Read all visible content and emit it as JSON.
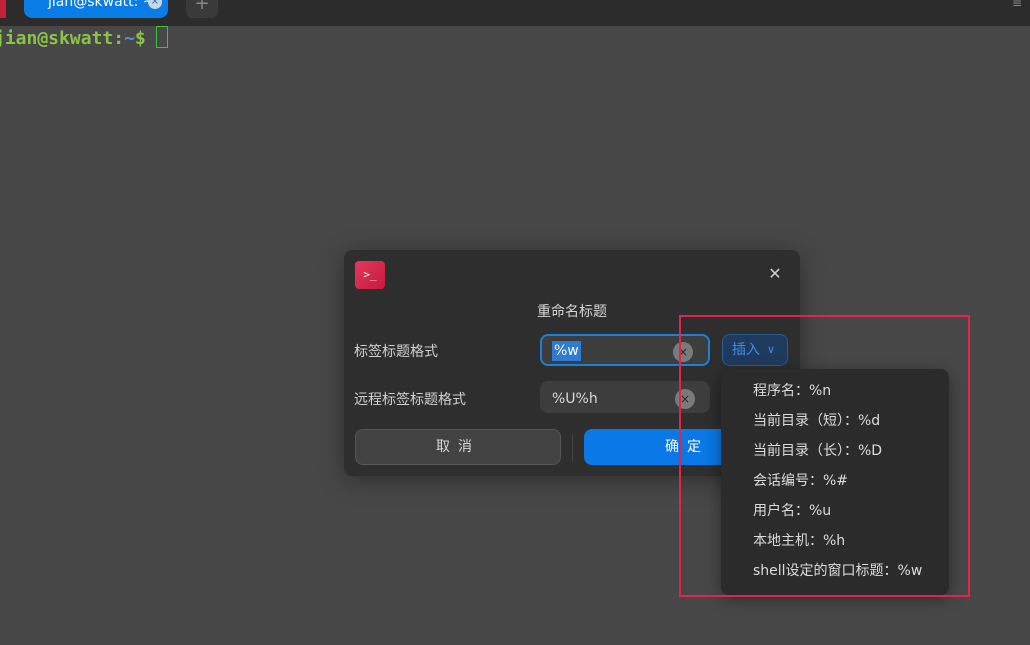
{
  "tabs": {
    "active_label": "jian@skwatt: ~",
    "close_glyph": "×",
    "add_glyph": "+"
  },
  "terminal": {
    "prompt_user": "jian@skwatt",
    "prompt_colon": ":",
    "prompt_path": "~",
    "prompt_dollar": "$"
  },
  "dialog": {
    "app_icon_glyph": ">_",
    "close_glyph": "✕",
    "title": "重命名标题",
    "tab_title_format_label": "标签标题格式",
    "tab_title_format_value": "%w",
    "remote_tab_title_format_label": "远程标签标题格式",
    "remote_tab_title_format_value": "%U%h",
    "clear_glyph": "×",
    "insert_label": "插入",
    "insert_chevron": "∨",
    "cancel_label": "取消",
    "confirm_label": "确定"
  },
  "insert_menu": {
    "items": [
      "程序名：%n",
      "当前目录（短）：%d",
      "当前目录（长）：%D",
      "会话编号：%#",
      "用户名：%u",
      "本地主机：%h",
      "shell设定的窗口标题：%w"
    ]
  },
  "colors": {
    "accent": "#0a78e6",
    "highlight_box": "#e2234a",
    "prompt_green": "#8bc34a",
    "prompt_blue": "#5a8fd6"
  }
}
